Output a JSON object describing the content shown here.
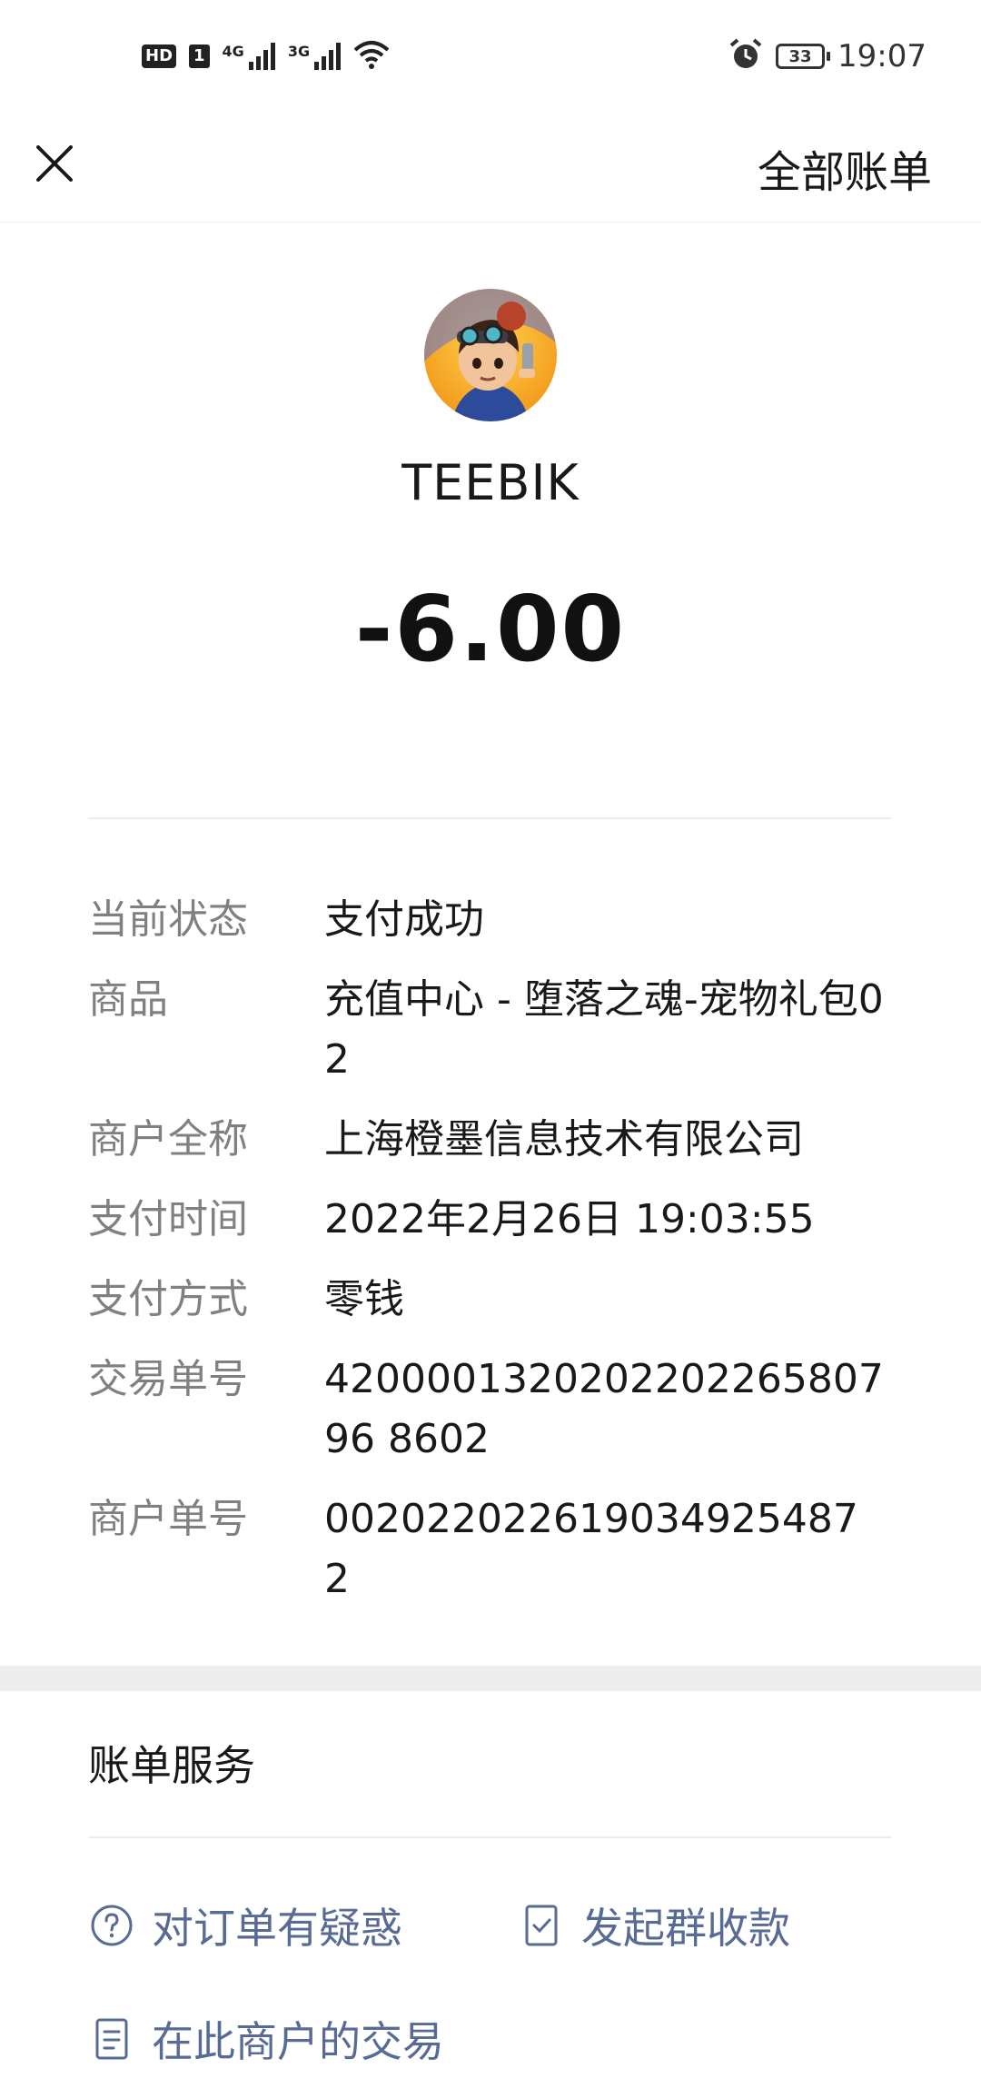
{
  "status_bar": {
    "hd": "HD",
    "sim": "1",
    "net1": "4G",
    "net2": "3G",
    "battery": "33",
    "time": "19:07"
  },
  "nav": {
    "right_label": "全部账单"
  },
  "merchant": {
    "name": "TEEBIK"
  },
  "amount": "-6.00",
  "details": [
    {
      "label": "当前状态",
      "value": "支付成功"
    },
    {
      "label": "商品",
      "value": "充值中心 - 堕落之魂-宠物礼包02"
    },
    {
      "label": "商户全称",
      "value": "上海橙墨信息技术有限公司"
    },
    {
      "label": "支付时间",
      "value": "2022年2月26日 19:03:55"
    },
    {
      "label": "支付方式",
      "value": "零钱"
    },
    {
      "label": "交易单号",
      "value": "420000132020220226580796 8602"
    },
    {
      "label": "商户单号",
      "value": "002022022619034925487 2"
    }
  ],
  "services": {
    "title": "账单服务",
    "question": "对订单有疑惑",
    "group_collect": "发起群收款",
    "merchant_tx": "在此商户的交易"
  },
  "colors": {
    "link": "#576b95",
    "label_gray": "#808080"
  }
}
